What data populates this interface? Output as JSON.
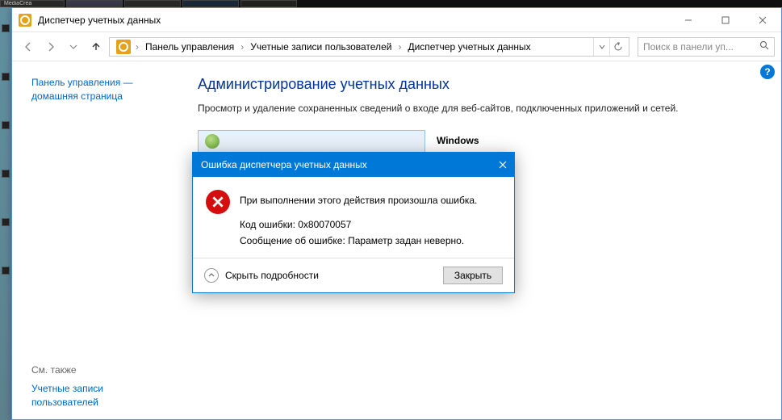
{
  "window": {
    "title": "Диспетчер учетных данных"
  },
  "taskbar": {
    "tab0": "MediaCrea"
  },
  "breadcrumb": {
    "items": [
      "Панель управления",
      "Учетные записи пользователей",
      "Диспетчер учетных данных"
    ]
  },
  "search": {
    "placeholder": "Поиск в панели уп..."
  },
  "sidebar": {
    "home": "Панель управления — домашняя страница",
    "seealso_header": "См. также",
    "seealso_link": "Учетные записи пользователей"
  },
  "main": {
    "heading": "Администрирование учетных данных",
    "description": "Просмотр и удаление сохраненных сведений о входе для веб-сайтов, подключенных приложений и сетей.",
    "tile_right_suffix": "Windows"
  },
  "help": {
    "glyph": "?"
  },
  "dialog": {
    "title": "Ошибка диспетчера учетных данных",
    "headline": "При выполнении этого действия произошла ошибка.",
    "code_line": "Код ошибки: 0x80070057",
    "msg_line": "Сообщение об ошибке: Параметр задан неверно.",
    "toggle_label": "Скрыть подробности",
    "close_btn": "Закрыть"
  }
}
